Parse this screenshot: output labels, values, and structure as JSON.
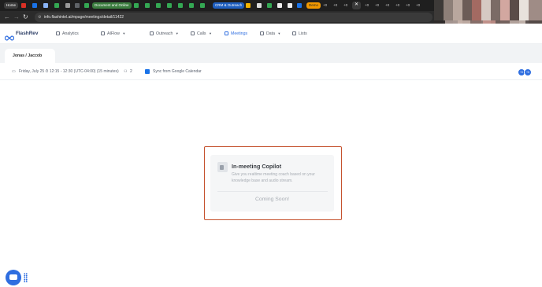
{
  "browser": {
    "tabs": {
      "home": "Home",
      "document_group": "Document and Online",
      "crm_group": "CRM & Outreach",
      "demo": "Demo",
      "plus_label": "+0"
    },
    "address": {
      "url": "info.flashintel.ai/mpage/meetings/detail/11422"
    }
  },
  "app": {
    "logo": "FlashRev",
    "nav": [
      {
        "label": "Analytics",
        "icon": "chart-icon"
      },
      {
        "label": "AIFlow",
        "icon": "ai-icon",
        "dropdown": true
      },
      {
        "label": "Outreach",
        "icon": "outreach-icon",
        "dropdown": true
      },
      {
        "label": "Calls",
        "icon": "phone-icon",
        "dropdown": true
      },
      {
        "label": "Meetings",
        "icon": "meeting-icon",
        "active": true
      },
      {
        "label": "Data",
        "icon": "data-icon",
        "dropdown": true
      },
      {
        "label": "Lists",
        "icon": "list-icon"
      }
    ],
    "tab": {
      "title": "Jonas / Jaccob"
    },
    "info": {
      "time": "Friday, July 25  ⏱ 12:15 - 12:30 (UTC-04:00) (15 minutes)",
      "attendee_count": "2",
      "sync_label": "Sync from Google Calendar"
    },
    "avatars": [
      "+0",
      "+0"
    ],
    "copilot": {
      "title": "In-meeting Copilot",
      "description": "Give you realtime meeting coach based on your knowledge base and audio stream.",
      "status": "Coming Soon!"
    }
  },
  "colors": {
    "accent": "#2f6ee0",
    "frame": "#c5522e",
    "chrome": "#1f1f1f"
  }
}
